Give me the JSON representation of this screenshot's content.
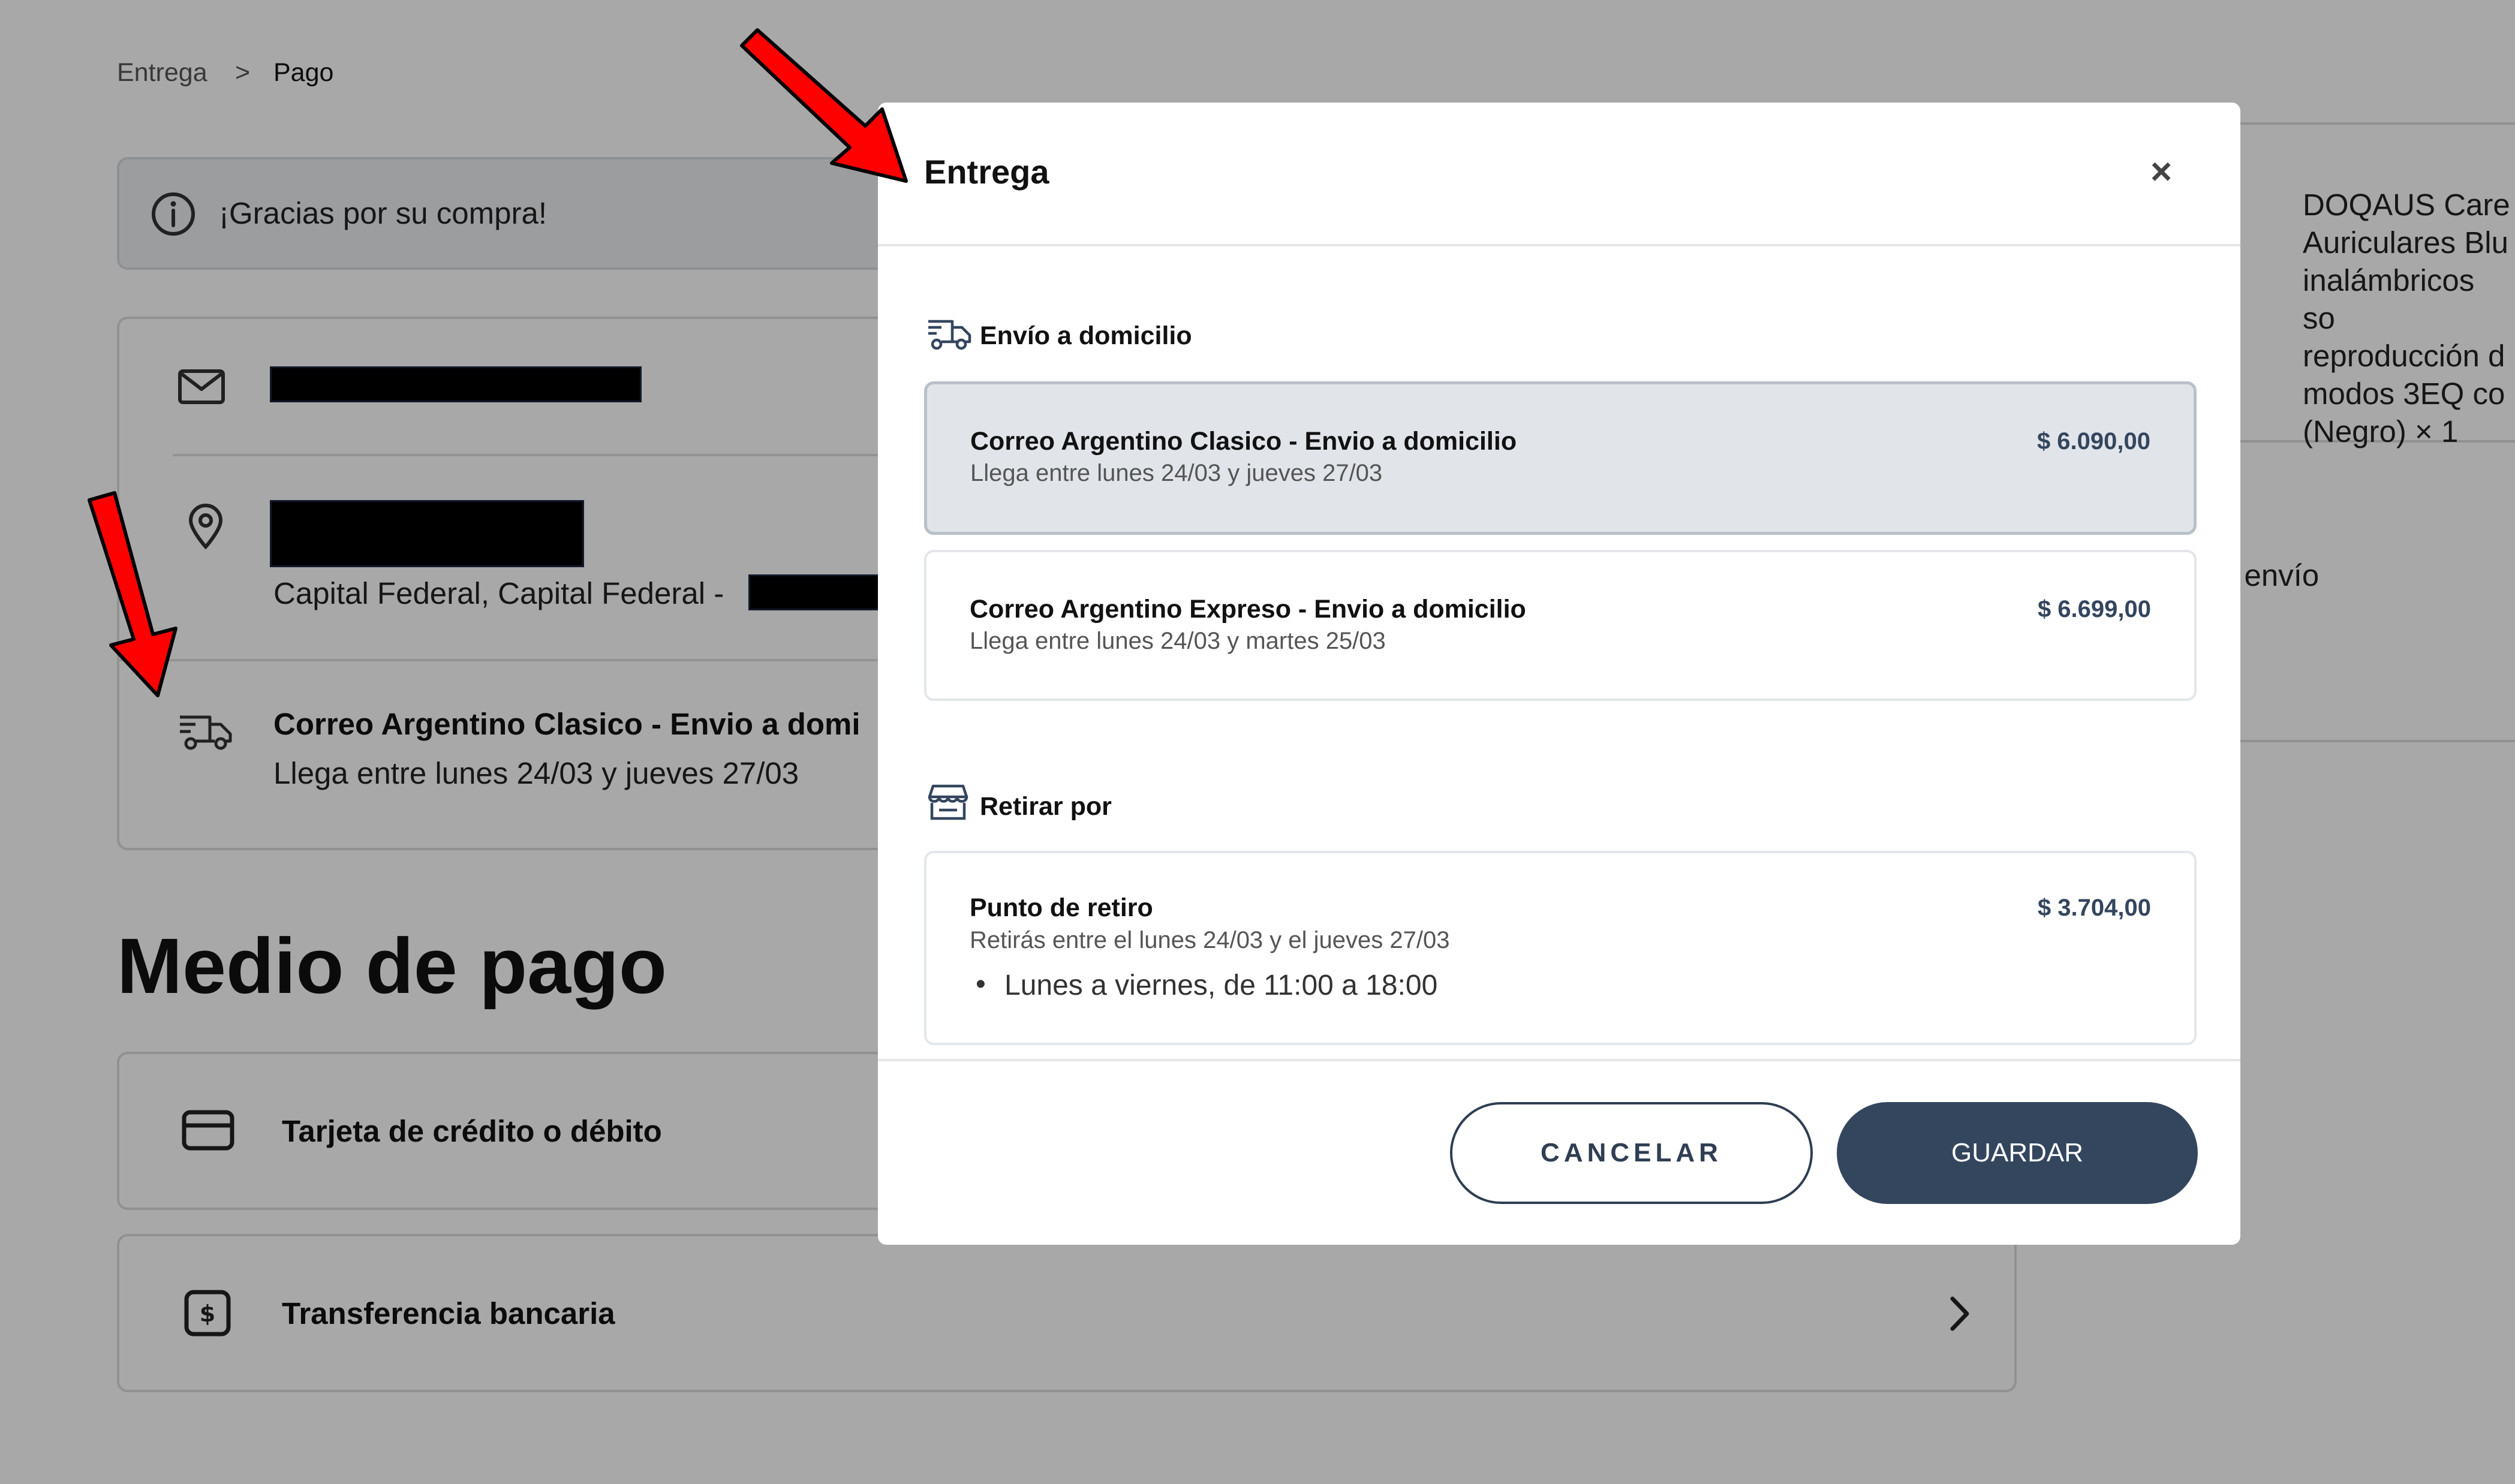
{
  "breadcrumb": {
    "items": [
      "Entrega",
      "Pago"
    ],
    "separator": ">"
  },
  "alert": {
    "text": "¡Gracias por su compra!"
  },
  "info_card": {
    "address_line": "Capital Federal, Capital Federal -",
    "shipping_name": "Correo Argentino Clasico - Envio a domi",
    "shipping_eta": "Llega entre lunes 24/03 y jueves 27/03"
  },
  "payment": {
    "title": "Medio de pago",
    "options": [
      "Tarjeta de crédito o débito",
      "Transferencia bancaria"
    ]
  },
  "product": {
    "lines": [
      "DOQAUS Care",
      "Auriculares Blu",
      "inalámbricos so",
      "reproducción d",
      "modos 3EQ co",
      "(Negro) × 1"
    ],
    "side_text": "e envío"
  },
  "modal": {
    "title": "Entrega",
    "close": "×",
    "home_section": "Envío a domicilio",
    "home_options": [
      {
        "name": "Correo Argentino Clasico - Envio a domicilio",
        "eta": "Llega entre lunes 24/03 y jueves 27/03",
        "price": "$ 6.090,00",
        "selected": true
      },
      {
        "name": "Correo Argentino Expreso - Envio a domicilio",
        "eta": "Llega entre lunes 24/03 y martes 25/03",
        "price": "$ 6.699,00",
        "selected": false
      }
    ],
    "pickup_section": "Retirar por",
    "pickup_option": {
      "name": "Punto de retiro",
      "eta": "Retirás entre el lunes 24/03 y el jueves 27/03",
      "hours": "Lunes a viernes, de 11:00 a 18:00",
      "price": "$ 3.704,00"
    },
    "cancel": "CANCELAR",
    "save": "GUARDAR"
  },
  "colors": {
    "primary": "#34465e",
    "annotation": "#ff0000",
    "selected_bg": "#e1e5ea"
  }
}
